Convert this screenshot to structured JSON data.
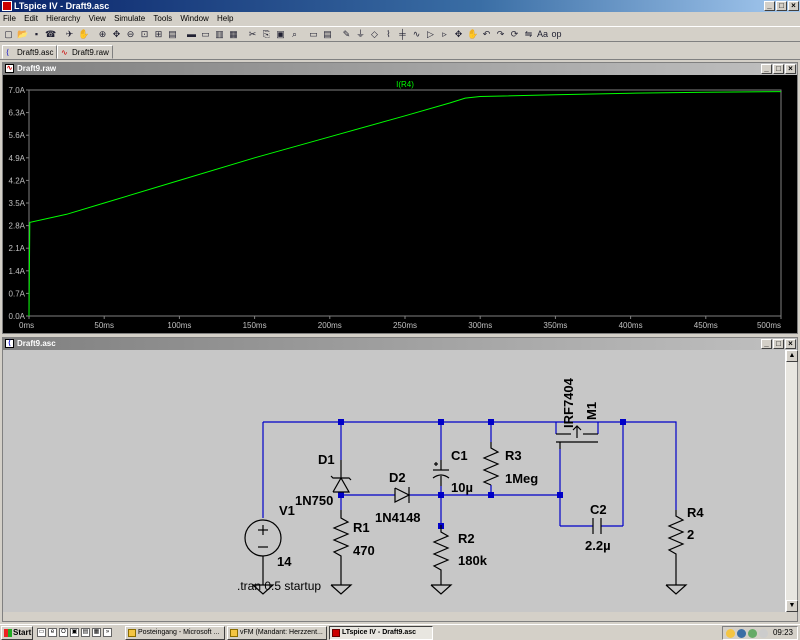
{
  "app": {
    "title": "LTspice IV - Draft9.asc",
    "window_buttons": [
      "_",
      "□",
      "×"
    ]
  },
  "menu": [
    "File",
    "Edit",
    "Hierarchy",
    "View",
    "Simulate",
    "Tools",
    "Window",
    "Help"
  ],
  "toolbar_icons": [
    "new-schematic-icon",
    "open-icon",
    "save-icon",
    "control-panel-icon",
    "run-icon",
    "halt-icon",
    "zoom-in-icon",
    "pan-icon",
    "zoom-out-icon",
    "zoom-fit-icon",
    "autorange-icon",
    "fft-icon",
    "tile-horizontal-icon",
    "cascade-icon",
    "tile-vertical-icon",
    "close-all-icon",
    "cut-icon",
    "copy-icon",
    "paste-icon",
    "find-icon",
    "print-setup-icon",
    "print-icon",
    "wire-icon",
    "ground-icon",
    "label-net-icon",
    "resistor-icon",
    "capacitor-icon",
    "inductor-icon",
    "diode-icon",
    "component-icon",
    "move-icon",
    "drag-icon",
    "undo-icon",
    "redo-icon",
    "rotate-icon",
    "mirror-icon",
    "text-icon",
    "spice-directive-icon"
  ],
  "tabs": [
    {
      "label": "Draft9.asc",
      "icon": "schematic-icon"
    },
    {
      "label": "Draft9.raw",
      "icon": "waveform-icon"
    }
  ],
  "plot_window": {
    "title": "Draft9.raw",
    "buttons": [
      "_",
      "□",
      "×"
    ]
  },
  "chart_data": {
    "type": "line",
    "title": "",
    "trace_label": "I(R4)",
    "xlabel": "",
    "ylabel": "",
    "xlim": [
      0,
      500
    ],
    "ylim": [
      0,
      7.0
    ],
    "x_ticks": [
      "0ms",
      "50ms",
      "100ms",
      "150ms",
      "200ms",
      "250ms",
      "300ms",
      "350ms",
      "400ms",
      "450ms",
      "500ms"
    ],
    "y_ticks": [
      "0.0A",
      "0.7A",
      "1.4A",
      "2.1A",
      "2.8A",
      "3.5A",
      "4.2A",
      "4.9A",
      "5.6A",
      "6.3A",
      "7.0A"
    ],
    "series": [
      {
        "name": "I(R4)",
        "color": "#00ff00",
        "x": [
          0,
          0.5,
          25,
          50,
          100,
          150,
          200,
          250,
          280,
          290,
          300,
          350,
          400,
          450,
          500
        ],
        "y": [
          0,
          2.9,
          3.15,
          3.5,
          4.2,
          4.9,
          5.55,
          6.2,
          6.6,
          6.75,
          6.8,
          6.85,
          6.9,
          6.93,
          6.95
        ]
      }
    ],
    "background": "#000000",
    "axis_color": "#808080",
    "grid": false
  },
  "schematic_window": {
    "title": "Draft9.asc",
    "buttons": [
      "_",
      "□",
      "×"
    ],
    "labels": {
      "v1_name": "V1",
      "v1_value": "14",
      "d1_name": "D1",
      "d1_value": "1N750",
      "r1_name": "R1",
      "r1_value": "470",
      "d2_name": "D2",
      "d2_value": "1N4148",
      "c1_name": "C1",
      "c1_value": "10µ",
      "r2_name": "R2",
      "r2_value": "180k",
      "r3_name": "R3",
      "r3_value": "1Meg",
      "m1_name": "M1",
      "m1_value": "IRF7404",
      "c2_name": "C2",
      "c2_value": "2.2µ",
      "r4_name": "R4",
      "r4_value": "2",
      "directive": ".tran 0.5 startup"
    },
    "wire_color": "#0000c8",
    "component_color": "#000000",
    "background": "#c7c7c7"
  },
  "taskbar": {
    "start": "Start",
    "tasks": [
      {
        "label": "Posteingang - Microsoft ...",
        "active": false
      },
      {
        "label": "vFM (Mandant: Herzzent...",
        "active": false
      },
      {
        "label": "LTspice IV - Draft9.asc",
        "active": true
      }
    ],
    "clock": "09:23"
  }
}
